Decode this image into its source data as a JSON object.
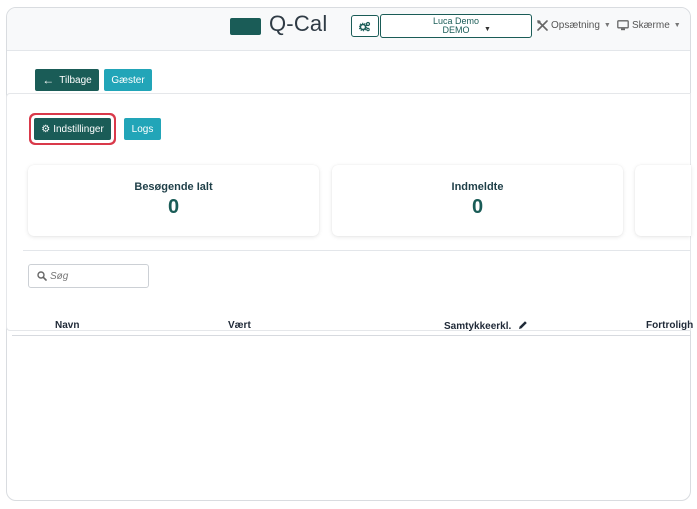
{
  "header": {
    "logo_text": "Q-Cal",
    "user": {
      "name": "Luca Demo",
      "org": "DEMO"
    },
    "menu": [
      {
        "label": "Opsætning",
        "icon": "tools-icon"
      },
      {
        "label": "Skærme",
        "icon": "monitor-icon"
      }
    ]
  },
  "toolbar": {
    "back_label": "Tilbage",
    "guests_label": "Gæster"
  },
  "actions": {
    "settings_label": "Indstillinger",
    "logs_label": "Logs"
  },
  "stats": [
    {
      "label": "Besøgende Ialt",
      "value": "0"
    },
    {
      "label": "Indmeldte",
      "value": "0"
    }
  ],
  "search": {
    "placeholder": "Søg"
  },
  "table": {
    "columns": [
      "Navn",
      "Vært",
      "Samtykkeerkl.",
      "Fortroligh"
    ]
  },
  "colors": {
    "brand": "#1a5c57",
    "teal": "#22a5b8",
    "focus": "#d9394a"
  }
}
